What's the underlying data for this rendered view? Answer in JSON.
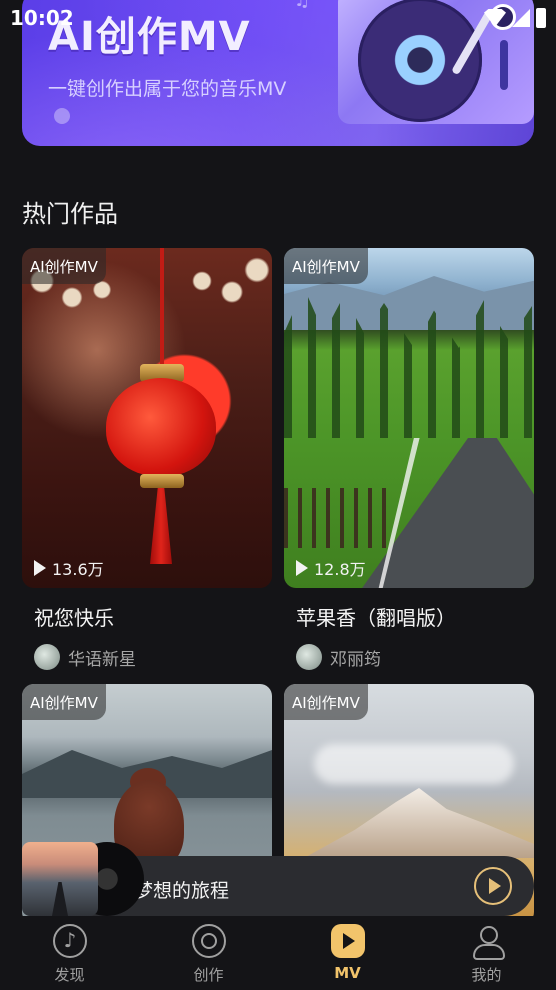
{
  "status_bar": {
    "time": "10:02"
  },
  "banner": {
    "title": "AI创作MV",
    "subtitle": "一键创作出属于您的音乐MV"
  },
  "section": {
    "title": "热门作品"
  },
  "cards": [
    {
      "tag": "AI创作MV",
      "plays": "13.6万",
      "title": "祝您快乐",
      "author": "华语新星"
    },
    {
      "tag": "AI创作MV",
      "plays": "12.8万",
      "title": "苹果香（翻唱版）",
      "author": "邓丽筠"
    },
    {
      "tag": "AI创作MV"
    },
    {
      "tag": "AI创作MV"
    }
  ],
  "player": {
    "title": "梦想的旅程"
  },
  "tabbar": {
    "tabs": [
      {
        "label": "发现",
        "icon": "music-disc-icon"
      },
      {
        "label": "创作",
        "icon": "create-target-icon"
      },
      {
        "label": "MV",
        "icon": "mv-play-icon",
        "active": true
      },
      {
        "label": "我的",
        "icon": "profile-icon"
      }
    ],
    "active_color": "#f2c46b"
  },
  "colors": {
    "background": "#141417",
    "accent": "#f2c46b",
    "banner": "#6d4ef0"
  }
}
